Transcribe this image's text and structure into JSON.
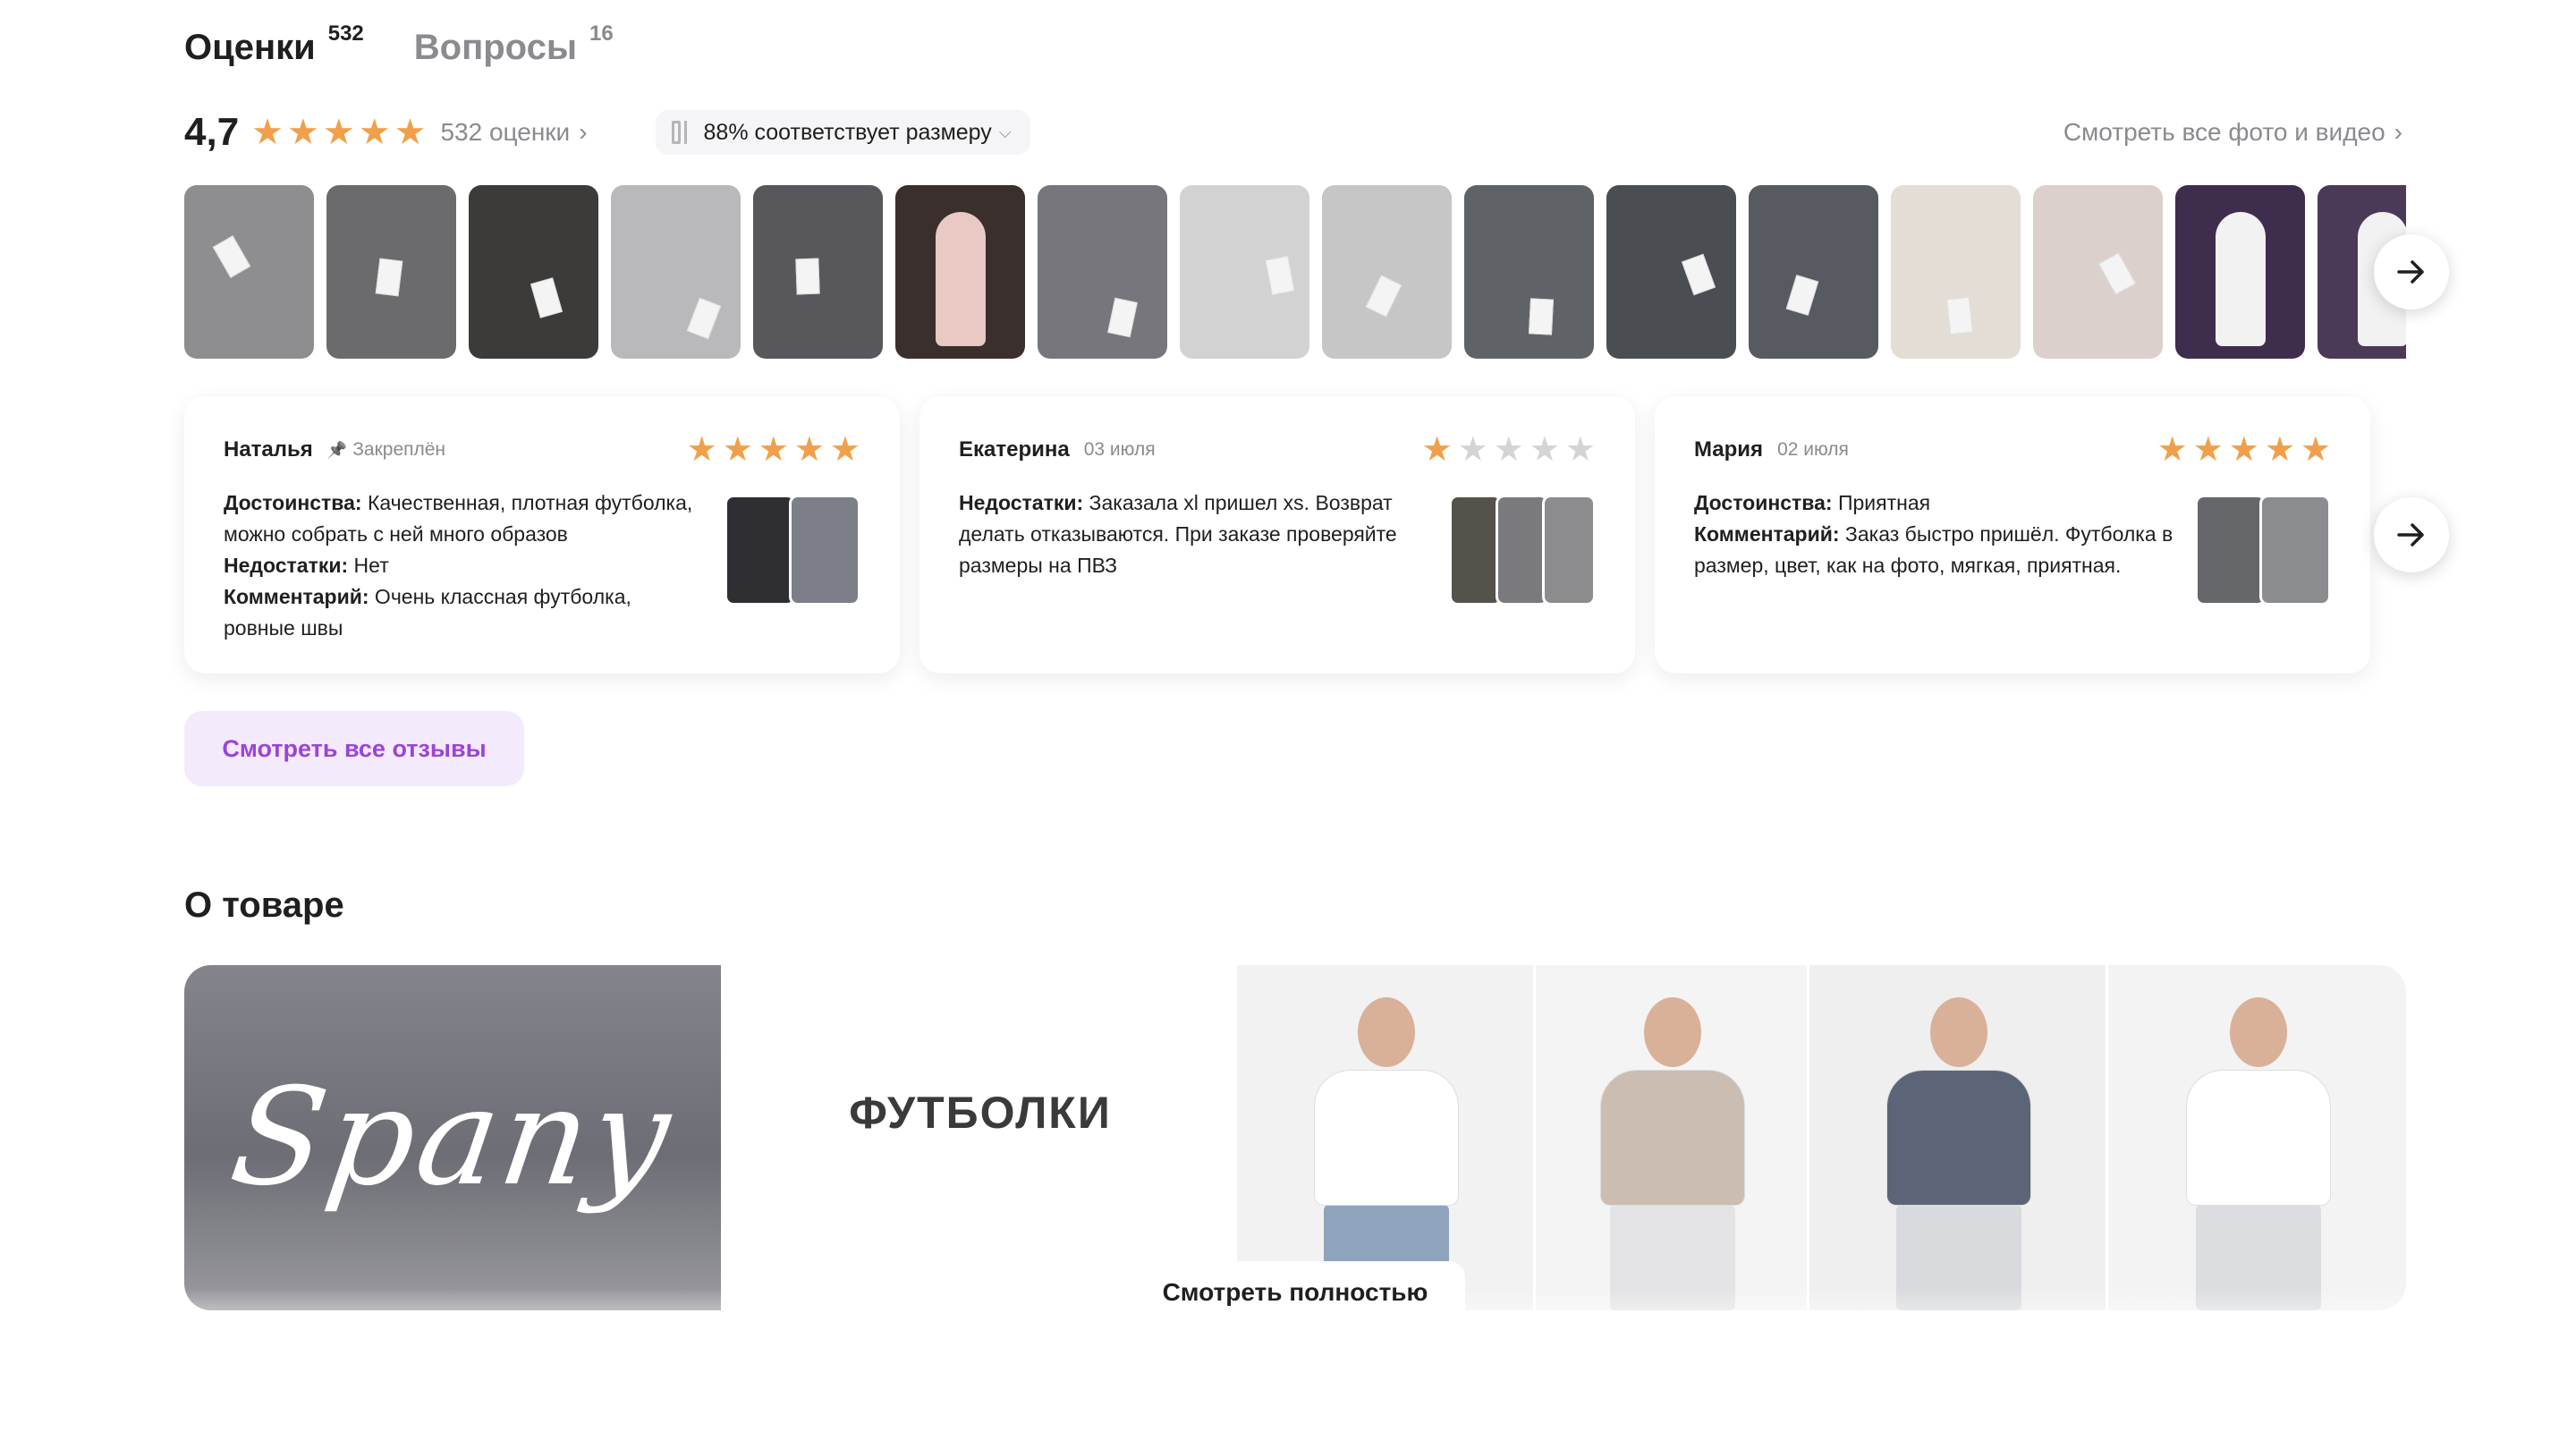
{
  "tabs": [
    {
      "label": "Оценки",
      "count": "532"
    },
    {
      "label": "Вопросы",
      "count": "16"
    }
  ],
  "rating": {
    "value": "4,7",
    "stars_filled": 5,
    "count_text": "532 оценки",
    "size_fit": "88% соответствует размеру",
    "all_media_link": "Смотреть все фото и видео"
  },
  "photos": [
    {
      "bg": "#8e8e90",
      "icon": "shirt-photo"
    },
    {
      "bg": "#6b6b6e",
      "icon": "shirt-photo"
    },
    {
      "bg": "#3d3b3a",
      "icon": "shirt-photo"
    },
    {
      "bg": "#b9b9bb",
      "icon": "shirt-photo"
    },
    {
      "bg": "#57575c",
      "icon": "shirt-photo"
    },
    {
      "bg": "#3a2f2c",
      "icon": "people-photo"
    },
    {
      "bg": "#76767c",
      "icon": "shirt-photo"
    },
    {
      "bg": "#d2d2d2",
      "icon": "shirt-photo"
    },
    {
      "bg": "#c6c6c6",
      "icon": "shirt-photo"
    },
    {
      "bg": "#5f6367",
      "icon": "shirt-photo"
    },
    {
      "bg": "#4a4d52",
      "icon": "shirt-photo"
    },
    {
      "bg": "#575a60",
      "icon": "shirt-photo"
    },
    {
      "bg": "#e3ddd6",
      "icon": "shirt-photo"
    },
    {
      "bg": "#dcd0cd",
      "icon": "shirt-photo"
    },
    {
      "bg": "#3f2d4e",
      "icon": "person-photo"
    },
    {
      "bg": "#4a3a57",
      "icon": "person-photo"
    }
  ],
  "reviews": [
    {
      "author": "Наталья",
      "meta": "Закреплён",
      "pinned": true,
      "rating": 5,
      "lines": [
        {
          "label": "Достоинства:",
          "text": " Качественная, плотная футболка, можно собрать с ней много образов"
        },
        {
          "label": "Недостатки:",
          "text": " Нет"
        },
        {
          "label": "Комментарий:",
          "text": " Очень классная футболка, ровные швы"
        }
      ],
      "photo_colors": [
        "#2f2f33",
        "#7c7f88"
      ]
    },
    {
      "author": "Екатерина",
      "meta": "03 июля",
      "pinned": false,
      "rating": 1,
      "lines": [
        {
          "label": "Недостатки:",
          "text": " Заказала xl пришел xs. Возврат делать отказываются. При заказе проверяйте размеры на ПВЗ"
        }
      ],
      "photo_colors": [
        "#55524c",
        "#7a7a7e",
        "#8c8c8e"
      ]
    },
    {
      "author": "Мария",
      "meta": "02 июля",
      "pinned": false,
      "rating": 5,
      "lines": [
        {
          "label": "Достоинства:",
          "text": " Приятная"
        },
        {
          "label": "Комментарий:",
          "text": " Заказ быстро пришёл. Футболка в размер, цвет, как на фото, мягкая, приятная."
        }
      ],
      "photo_colors": [
        "#66676b",
        "#8b8c8f"
      ]
    }
  ],
  "buttons": {
    "all_reviews": "Смотреть все отзывы",
    "expand": "Смотреть полностью"
  },
  "about": {
    "title": "О товаре",
    "brand": "Spany",
    "category": "ФУТБОЛКИ",
    "people": [
      {
        "shirt": "#ffffff",
        "pants": "#8fa3bd",
        "bg": "#f2f2f2"
      },
      {
        "shirt": "#cbbdb1",
        "pants": "#e4e4e6",
        "bg": "#f4f4f4"
      },
      {
        "shirt": "#5c6577",
        "pants": "#d8dadd",
        "bg": "#efefef"
      },
      {
        "shirt": "#ffffff",
        "pants": "#dcdde0",
        "bg": "#f3f3f3"
      }
    ]
  },
  "colors": {
    "star": "#f0a04b",
    "star_off": "#d4d4d6",
    "accent": "#9b44d6",
    "accent_bg": "#f3eafc"
  }
}
